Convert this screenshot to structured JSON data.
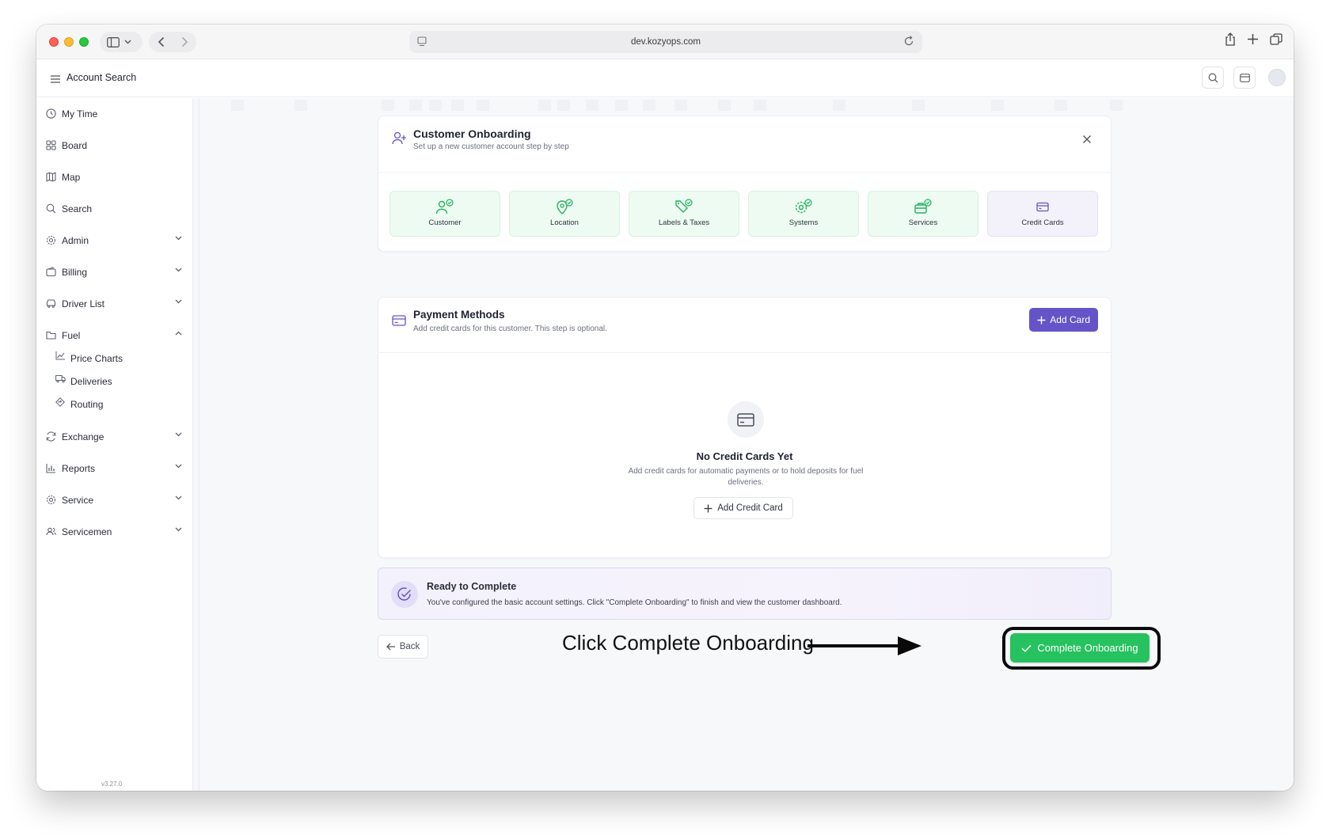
{
  "browser": {
    "url": "dev.kozyops.com"
  },
  "header": {
    "title": "Account Search"
  },
  "sidebar": {
    "items": [
      {
        "label": "My Time",
        "icon": "clock-icon"
      },
      {
        "label": "Board",
        "icon": "grid-icon"
      },
      {
        "label": "Map",
        "icon": "map-icon"
      },
      {
        "label": "Search",
        "icon": "search-icon"
      },
      {
        "label": "Admin",
        "icon": "gear-icon",
        "expandable": true
      },
      {
        "label": "Billing",
        "icon": "wallet-icon",
        "expandable": true
      },
      {
        "label": "Driver List",
        "icon": "truck-icon",
        "expandable": true
      },
      {
        "label": "Fuel",
        "icon": "folder-icon",
        "expanded": true
      },
      {
        "label": "Exchange",
        "icon": "refresh-icon",
        "expandable": true
      },
      {
        "label": "Reports",
        "icon": "bar-chart-icon",
        "expandable": true
      },
      {
        "label": "Service",
        "icon": "gear-icon",
        "expandable": true
      },
      {
        "label": "Servicemen",
        "icon": "users-icon",
        "expandable": true
      }
    ],
    "fuel_subitems": [
      {
        "label": "Price Charts",
        "icon": "line-chart-icon"
      },
      {
        "label": "Deliveries",
        "icon": "delivery-truck-icon"
      },
      {
        "label": "Routing",
        "icon": "route-icon"
      }
    ],
    "version": "v3.27.0"
  },
  "onboarding": {
    "title": "Customer Onboarding",
    "subtitle": "Set up a new customer account step by step",
    "steps": [
      {
        "label": "Customer",
        "status": "complete"
      },
      {
        "label": "Location",
        "status": "complete"
      },
      {
        "label": "Labels & Taxes",
        "status": "complete"
      },
      {
        "label": "Systems",
        "status": "complete"
      },
      {
        "label": "Services",
        "status": "complete"
      },
      {
        "label": "Credit Cards",
        "status": "current"
      }
    ]
  },
  "payment": {
    "title": "Payment Methods",
    "subtitle": "Add credit cards for this customer. This step is optional.",
    "add_button": "Add Card",
    "empty_title": "No Credit Cards Yet",
    "empty_desc": "Add credit cards for automatic payments or to hold deposits for fuel deliveries.",
    "add_cc_button": "Add Credit Card"
  },
  "ready": {
    "title": "Ready to Complete",
    "desc": "You've configured the basic account settings. Click \"Complete Onboarding\" to finish and view the customer dashboard."
  },
  "footer": {
    "back": "Back",
    "complete": "Complete Onboarding"
  },
  "annotation": {
    "text": "Click Complete Onboarding"
  },
  "colors": {
    "accent": "#6553c8",
    "success": "#27c260",
    "step_complete_bg": "#eefbf2",
    "step_icon_green": "#22b35e"
  }
}
